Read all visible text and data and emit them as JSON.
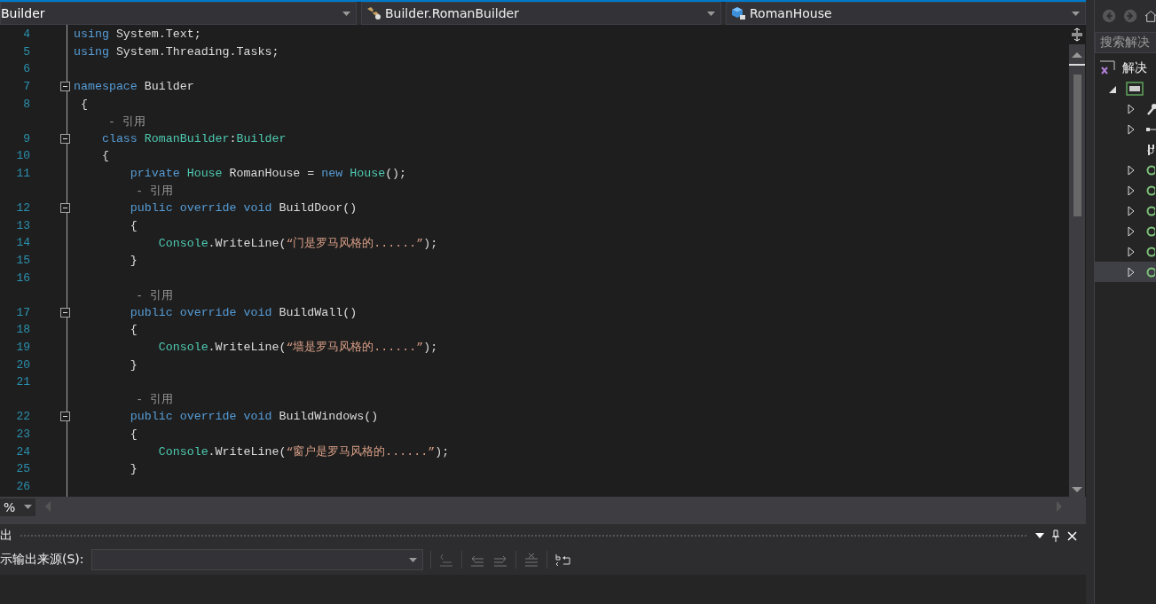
{
  "navbar": {
    "dropdowns": [
      {
        "kind": "plain",
        "text": "Builder"
      },
      {
        "kind": "class",
        "text": "Builder.RomanBuilder"
      },
      {
        "kind": "field",
        "text": "RomanHouse"
      }
    ]
  },
  "editor": {
    "lines": [
      {
        "kind": "code",
        "number": "4",
        "fold": false,
        "tokens": [
          {
            "kind": "kw",
            "text": "using"
          },
          {
            "kind": "plain",
            "text": " System.Text;"
          }
        ]
      },
      {
        "kind": "code",
        "number": "5",
        "fold": false,
        "tokens": [
          {
            "kind": "kw",
            "text": "using"
          },
          {
            "kind": "plain",
            "text": " System.Threading.Tasks;"
          }
        ]
      },
      {
        "kind": "code",
        "number": "6",
        "fold": false
      },
      {
        "kind": "code",
        "number": "7",
        "fold": true,
        "tokens": [
          {
            "kind": "kw",
            "text": "namespace"
          },
          {
            "kind": "plain",
            "text": " Builder"
          }
        ]
      },
      {
        "kind": "code",
        "number": "8",
        "fold": false,
        "tokens": [
          {
            "kind": "plain",
            "text": " {"
          }
        ]
      },
      {
        "kind": "lens",
        "text": "     - 引用"
      },
      {
        "kind": "code",
        "number": "9",
        "fold": true,
        "tokens": [
          {
            "kind": "kw",
            "text": "    class "
          },
          {
            "kind": "type",
            "text": "RomanBuilder"
          },
          {
            "kind": "plain",
            "text": ":"
          },
          {
            "kind": "type",
            "text": "Builder"
          }
        ]
      },
      {
        "kind": "code",
        "number": "10",
        "fold": false,
        "tokens": [
          {
            "kind": "plain",
            "text": "    {"
          }
        ]
      },
      {
        "kind": "code",
        "number": "11",
        "fold": false,
        "tokens": [
          {
            "kind": "kw",
            "text": "        private "
          },
          {
            "kind": "type",
            "text": "House"
          },
          {
            "kind": "plain",
            "text": " RomanHouse = "
          },
          {
            "kind": "kw",
            "text": "new "
          },
          {
            "kind": "type",
            "text": "House"
          },
          {
            "kind": "plain",
            "text": "();"
          }
        ]
      },
      {
        "kind": "lens",
        "text": "         - 引用"
      },
      {
        "kind": "code",
        "number": "12",
        "fold": true,
        "tokens": [
          {
            "kind": "kw",
            "text": "        public override void"
          },
          {
            "kind": "plain",
            "text": " BuildDoor()"
          }
        ]
      },
      {
        "kind": "code",
        "number": "13",
        "fold": false,
        "tokens": [
          {
            "kind": "plain",
            "text": "        {"
          }
        ]
      },
      {
        "kind": "code",
        "number": "14",
        "fold": false,
        "tokens": [
          {
            "kind": "type",
            "text": "            Console"
          },
          {
            "kind": "plain",
            "text": ".WriteLine("
          },
          {
            "kind": "str",
            "text": "“门是罗马风格的......”"
          },
          {
            "kind": "plain",
            "text": ");"
          }
        ]
      },
      {
        "kind": "code",
        "number": "15",
        "fold": false,
        "tokens": [
          {
            "kind": "plain",
            "text": "        }"
          }
        ]
      },
      {
        "kind": "code",
        "number": "16",
        "fold": false
      },
      {
        "kind": "lens",
        "text": "         - 引用"
      },
      {
        "kind": "code",
        "number": "17",
        "fold": true,
        "tokens": [
          {
            "kind": "kw",
            "text": "        public override void"
          },
          {
            "kind": "plain",
            "text": " BuildWall()"
          }
        ]
      },
      {
        "kind": "code",
        "number": "18",
        "fold": false,
        "tokens": [
          {
            "kind": "plain",
            "text": "        {"
          }
        ]
      },
      {
        "kind": "code",
        "number": "19",
        "fold": false,
        "tokens": [
          {
            "kind": "type",
            "text": "            Console"
          },
          {
            "kind": "plain",
            "text": ".WriteLine("
          },
          {
            "kind": "str",
            "text": "“墙是罗马风格的......”"
          },
          {
            "kind": "plain",
            "text": ");"
          }
        ]
      },
      {
        "kind": "code",
        "number": "20",
        "fold": false,
        "tokens": [
          {
            "kind": "plain",
            "text": "        }"
          }
        ]
      },
      {
        "kind": "code",
        "number": "21",
        "fold": false
      },
      {
        "kind": "lens",
        "text": "         - 引用"
      },
      {
        "kind": "code",
        "number": "22",
        "fold": true,
        "tokens": [
          {
            "kind": "kw",
            "text": "        public override void"
          },
          {
            "kind": "plain",
            "text": " BuildWindows()"
          }
        ]
      },
      {
        "kind": "code",
        "number": "23",
        "fold": false,
        "tokens": [
          {
            "kind": "plain",
            "text": "        {"
          }
        ]
      },
      {
        "kind": "code",
        "number": "24",
        "fold": false,
        "tokens": [
          {
            "kind": "type",
            "text": "            Console"
          },
          {
            "kind": "plain",
            "text": ".WriteLine("
          },
          {
            "kind": "str",
            "text": "“窗户是罗马风格的......”"
          },
          {
            "kind": "plain",
            "text": ");"
          }
        ]
      },
      {
        "kind": "code",
        "number": "25",
        "fold": false,
        "tokens": [
          {
            "kind": "plain",
            "text": "        }"
          }
        ]
      },
      {
        "kind": "code",
        "number": "26",
        "fold": false
      }
    ],
    "zoom": "%"
  },
  "output": {
    "title": "出",
    "source_label": "示输出来源(S):"
  },
  "solution_explorer": {
    "search": {
      "placeholder": "搜索解决"
    },
    "tree": [
      {
        "kind": "solution",
        "text": "解决",
        "children": [
          {
            "kind": "project",
            "expanded": true,
            "children": [
              {
                "kind": "properties",
                "expanded": false,
                "selected": false
              },
              {
                "kind": "references",
                "expanded": false,
                "selected": false
              },
              {
                "kind": "config",
                "selected": false
              },
              {
                "kind": "code",
                "expanded": false,
                "selected": false
              },
              {
                "kind": "code",
                "expanded": false,
                "selected": false
              },
              {
                "kind": "code",
                "expanded": false,
                "selected": false
              },
              {
                "kind": "code",
                "expanded": false,
                "selected": false
              },
              {
                "kind": "code",
                "expanded": false,
                "selected": false
              },
              {
                "kind": "code",
                "expanded": false,
                "selected": true
              }
            ]
          }
        ]
      }
    ]
  }
}
